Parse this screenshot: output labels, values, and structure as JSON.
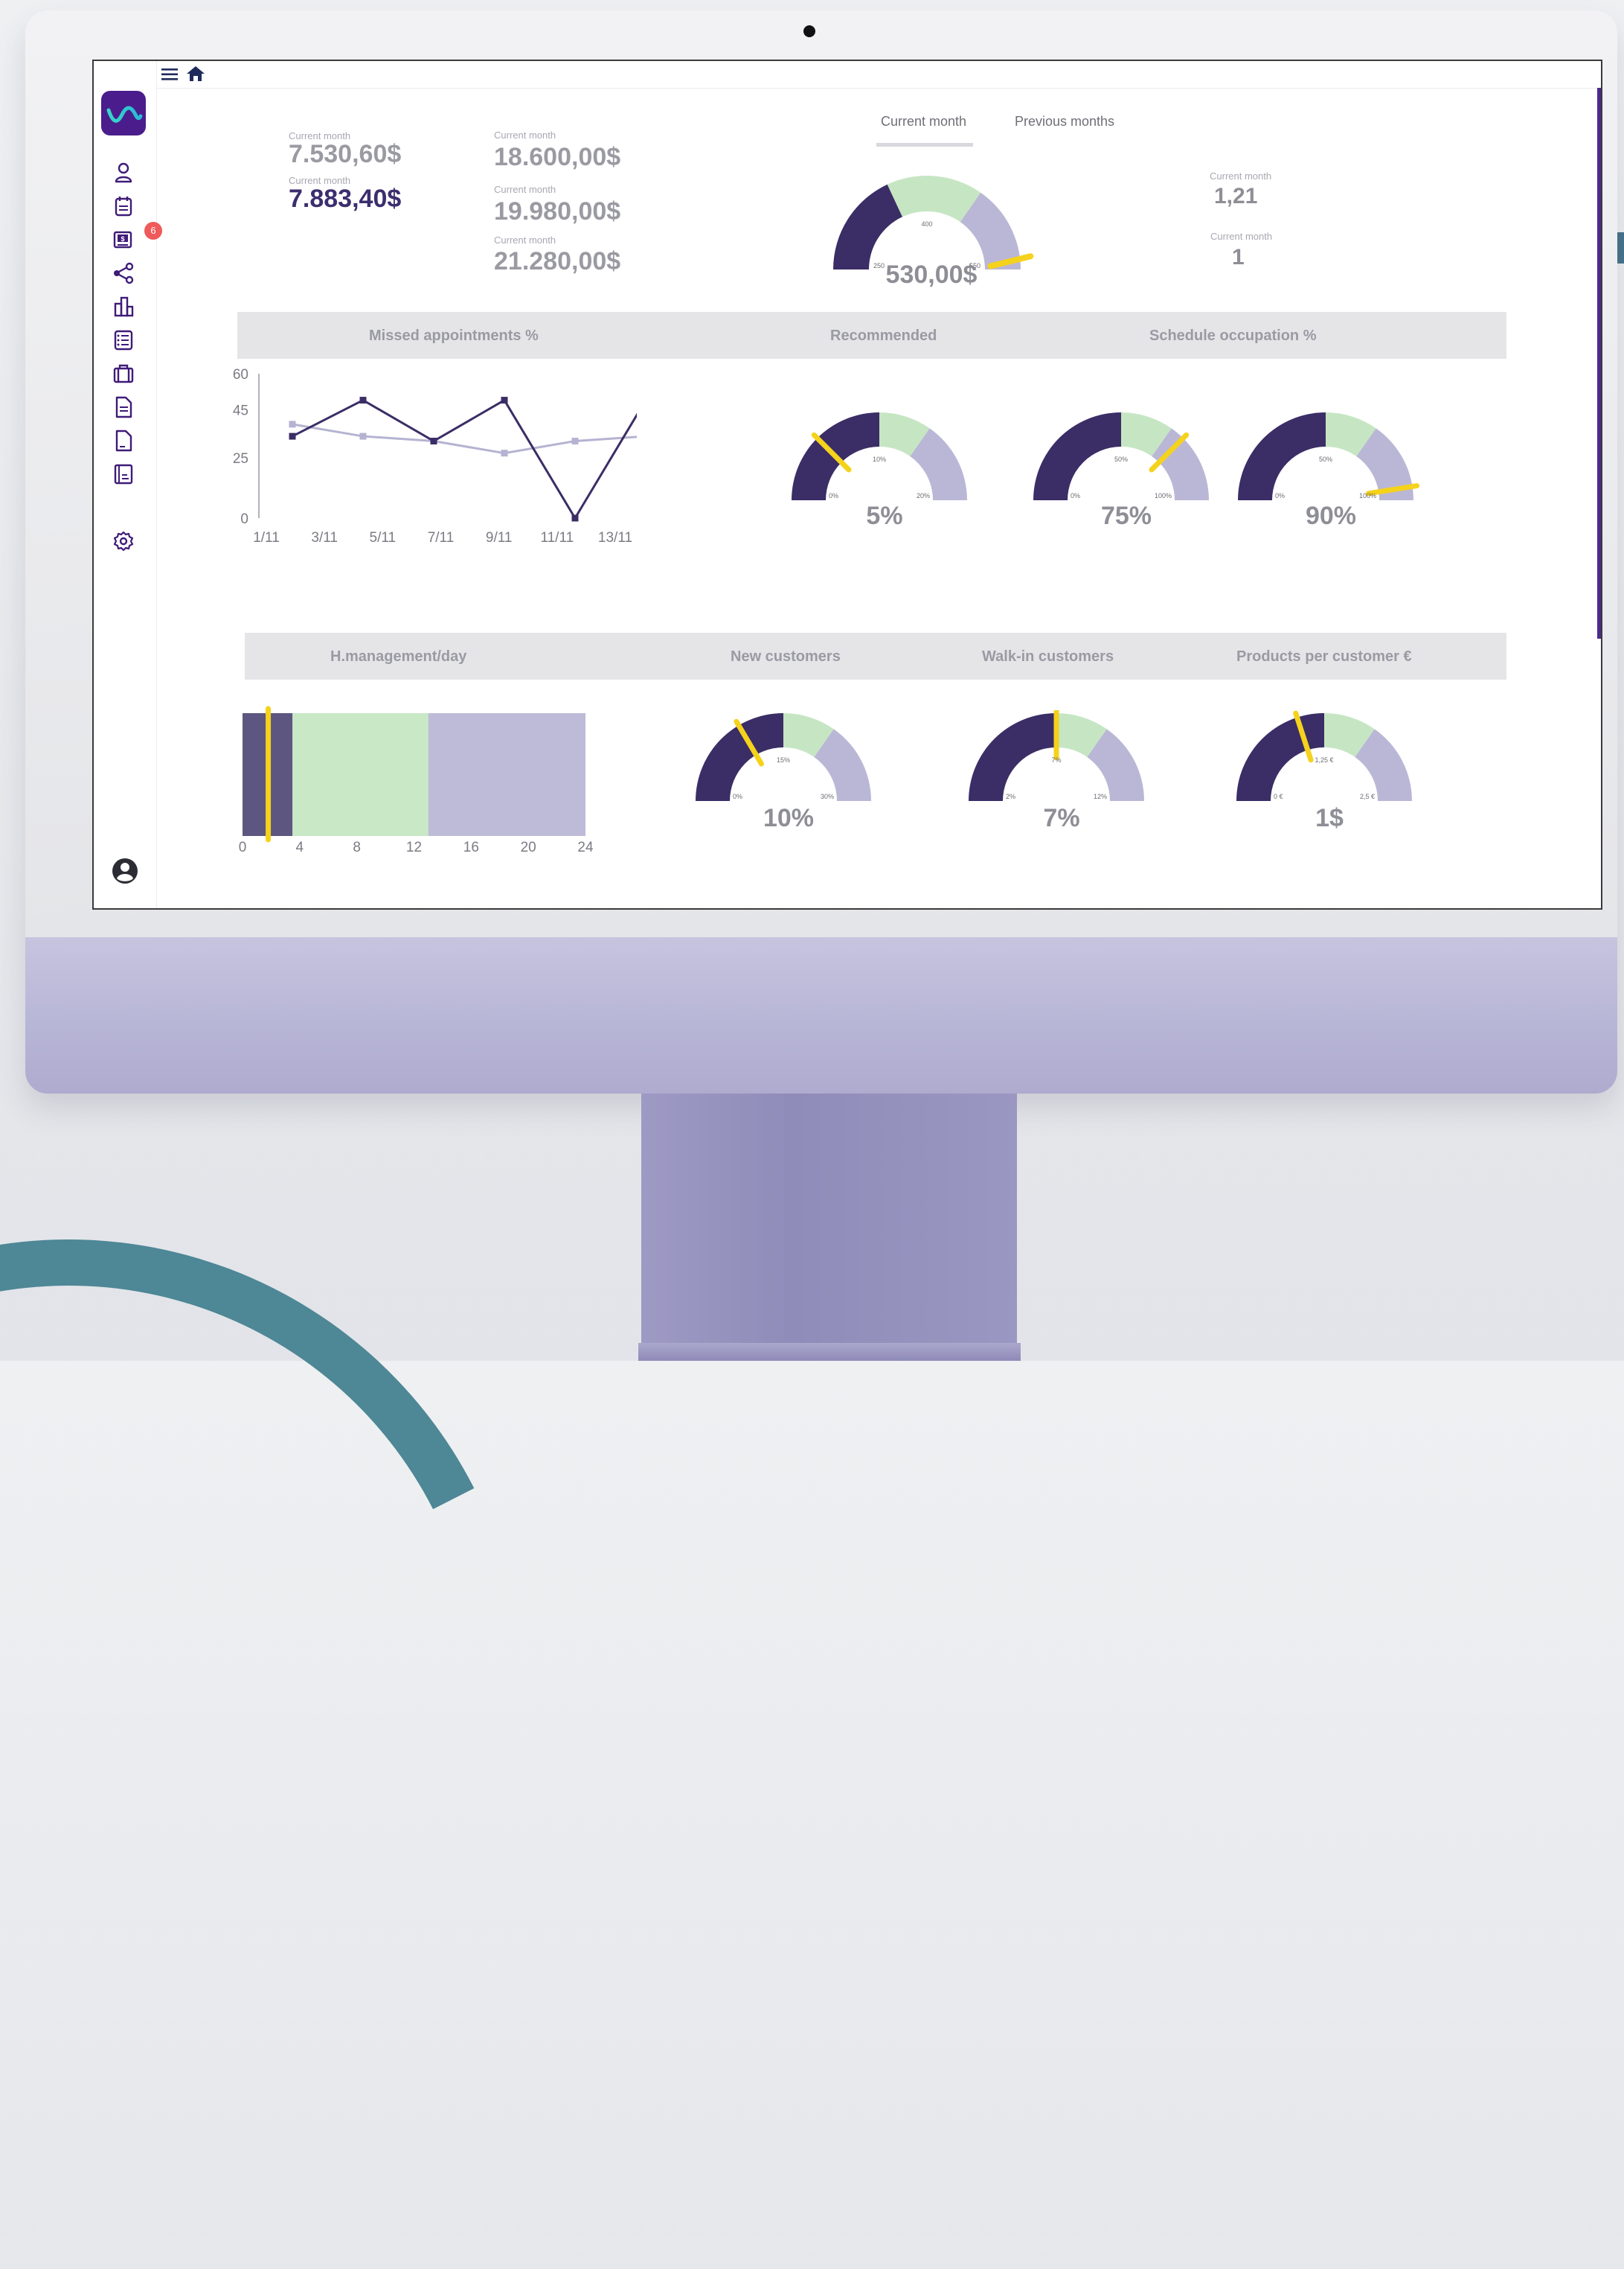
{
  "topbar": {
    "menu_icon": "hamburger-icon",
    "home_icon": "home-icon"
  },
  "sidebar": {
    "logo": "wave-logo",
    "items": [
      {
        "name": "user-icon"
      },
      {
        "name": "calendar-icon"
      },
      {
        "name": "billing-icon",
        "badge": "6"
      },
      {
        "name": "share-icon"
      },
      {
        "name": "buildings-icon"
      },
      {
        "name": "checklist-icon"
      },
      {
        "name": "briefcase-icon"
      },
      {
        "name": "document-icon"
      },
      {
        "name": "file-icon"
      },
      {
        "name": "report-icon"
      },
      {
        "name": "settings-icon"
      }
    ],
    "avatar_icon": "account-circle-icon"
  },
  "summary": {
    "col1": [
      {
        "label": "Current month",
        "value": "7.530,60$"
      },
      {
        "label": "Current month",
        "value": "7.883,40$"
      }
    ],
    "col2": [
      {
        "label": "Current month",
        "value": "18.600,00$"
      },
      {
        "label": "Current month",
        "value": "19.980,00$"
      },
      {
        "label": "Current month",
        "value": "21.280,00$"
      }
    ],
    "right": [
      {
        "label": "Current month",
        "value": "1,21"
      },
      {
        "label": "Current month",
        "value": "1"
      }
    ]
  },
  "tabs": [
    {
      "label": "Current month",
      "active": true
    },
    {
      "label": "Previous months",
      "active": false
    }
  ],
  "main_gauge": {
    "value_label": "530,00$",
    "min": "250",
    "mid": "400",
    "max": "550",
    "value": 540
  },
  "section1": {
    "headers": [
      "Missed appointments %",
      "Recommended",
      "Schedule occupation %"
    ],
    "gauges": [
      {
        "value_label": "5%",
        "min": "0%",
        "mid": "10%",
        "max": "20%",
        "fraction": 0.25
      },
      {
        "value_label": "75%",
        "min": "0%",
        "mid": "50%",
        "max": "100%",
        "fraction": 0.75
      },
      {
        "value_label": "90%",
        "min": "0%",
        "mid": "50%",
        "max": "100%",
        "fraction": 0.95
      }
    ]
  },
  "section2": {
    "headers": [
      "H.management/day",
      "New customers",
      "Walk-in customers",
      "Products per customer €"
    ],
    "gauges": [
      {
        "value_label": "10%",
        "min": "0%",
        "mid": "15%",
        "max": "30%",
        "fraction": 0.33
      },
      {
        "value_label": "7%",
        "min": "2%",
        "mid": "7%",
        "max": "12%",
        "fraction": 0.5
      },
      {
        "value_label": "1$",
        "min": "0 €",
        "mid": "1,25 €",
        "max": "2,5 €",
        "fraction": 0.4
      }
    ]
  },
  "chart_data": [
    {
      "type": "line",
      "x": [
        "2/11",
        "4/11",
        "6/11",
        "8/11",
        "10/11",
        "12/11"
      ],
      "xticks": [
        "1/11",
        "3/11",
        "5/11",
        "7/11",
        "9/11",
        "11/11",
        "13/11"
      ],
      "yticks": [
        "0",
        "25",
        "45",
        "60"
      ],
      "series": [
        {
          "values": [
            34,
            49,
            32,
            49,
            0,
            49
          ],
          "color": "#3b2d66"
        },
        {
          "values": [
            39,
            34,
            32,
            27,
            32,
            34
          ],
          "color": "#b5b3d1"
        }
      ],
      "ylim": [
        0,
        60
      ]
    },
    {
      "type": "bar",
      "orientation": "horizontal",
      "segments": [
        {
          "from": 0,
          "to": 3.5,
          "color": "#5d5680"
        },
        {
          "from": 3.5,
          "to": 13,
          "color": "#c8e8c6"
        },
        {
          "from": 13,
          "to": 24,
          "color": "#bebbd8"
        }
      ],
      "marker": 1.8,
      "xticks": [
        "0",
        "4",
        "8",
        "12",
        "16",
        "20",
        "24"
      ],
      "xlim": [
        0,
        24
      ]
    }
  ],
  "colors": {
    "dark": "#3b2d66",
    "green": "#c6e6c3",
    "light": "#bab7d6",
    "needle": "#f5d21b",
    "brand": "#4b1d8c"
  }
}
